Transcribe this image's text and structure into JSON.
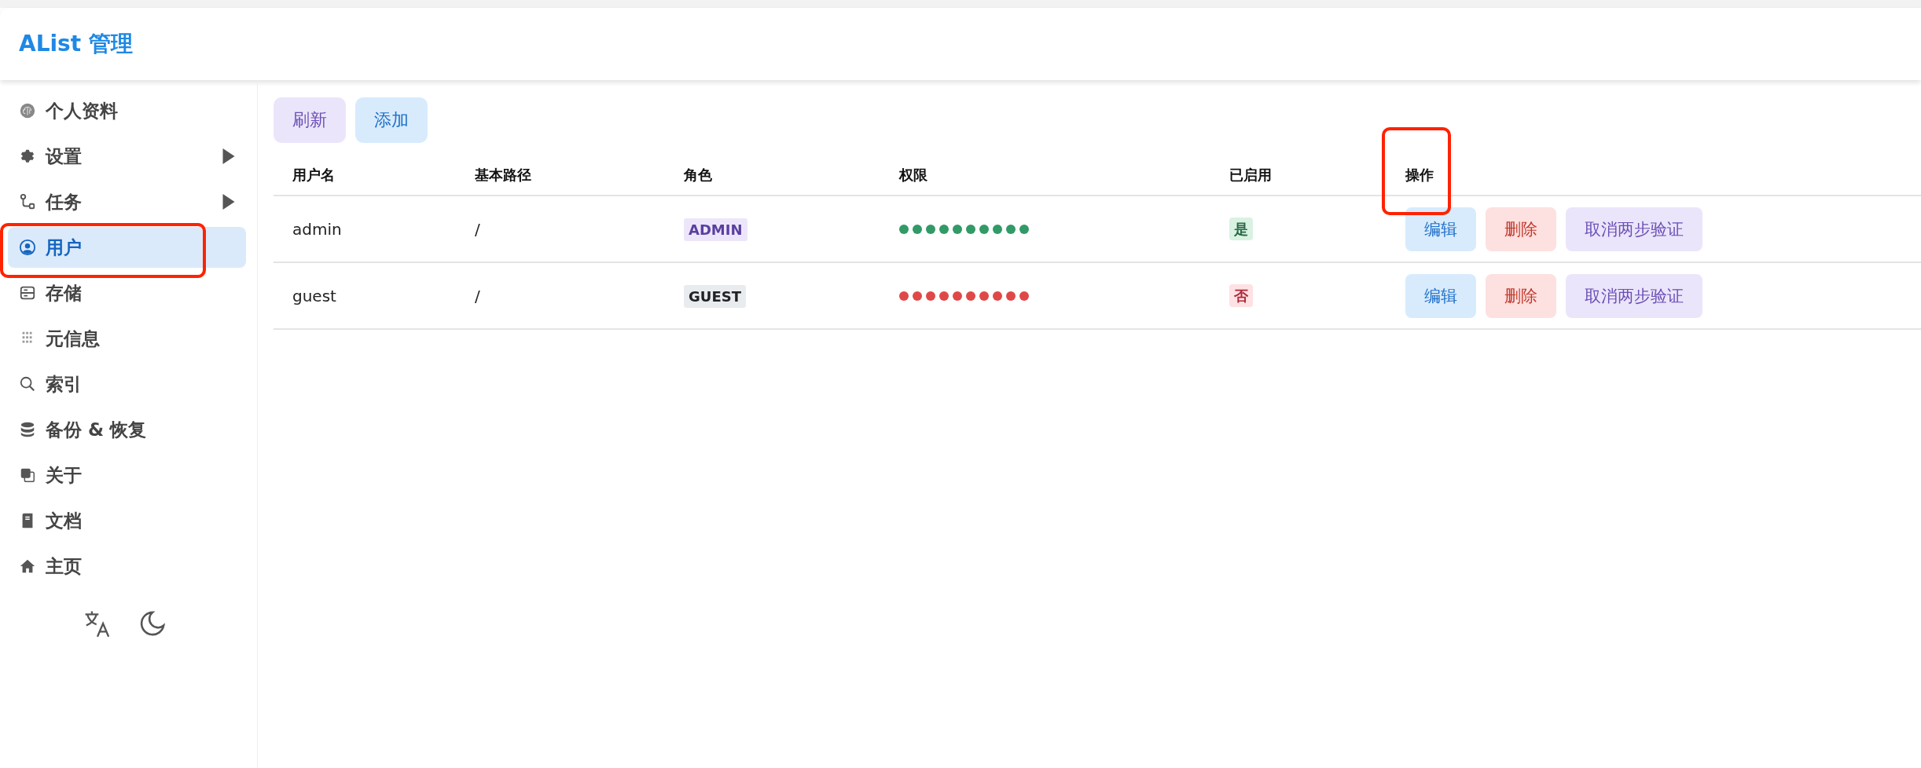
{
  "header": {
    "title": "AList 管理"
  },
  "sidebar": {
    "items": [
      {
        "label": "个人资料",
        "selected": false,
        "expandable": false,
        "annotated": false
      },
      {
        "label": "设置",
        "selected": false,
        "expandable": true,
        "annotated": false
      },
      {
        "label": "任务",
        "selected": false,
        "expandable": true,
        "annotated": false
      },
      {
        "label": "用户",
        "selected": true,
        "expandable": false,
        "annotated": true
      },
      {
        "label": "存储",
        "selected": false,
        "expandable": false,
        "annotated": false
      },
      {
        "label": "元信息",
        "selected": false,
        "expandable": false,
        "annotated": false
      },
      {
        "label": "索引",
        "selected": false,
        "expandable": false,
        "annotated": false
      },
      {
        "label": "备份 & 恢复",
        "selected": false,
        "expandable": false,
        "annotated": false
      },
      {
        "label": "关于",
        "selected": false,
        "expandable": false,
        "annotated": false
      },
      {
        "label": "文档",
        "selected": false,
        "expandable": false,
        "annotated": false
      },
      {
        "label": "主页",
        "selected": false,
        "expandable": false,
        "annotated": false
      }
    ]
  },
  "toolbar": {
    "buttons": [
      {
        "label": "刷新",
        "kind": "neutral"
      },
      {
        "label": "添加",
        "kind": "info"
      }
    ]
  },
  "table": {
    "columns": [
      "用户名",
      "基本路径",
      "角色",
      "权限",
      "已启用",
      "操作"
    ],
    "actions_annotated": true,
    "rows": [
      {
        "username": "admin",
        "base_path": "/",
        "role": {
          "label": "ADMIN",
          "kind": "admin"
        },
        "permissions": [
          true,
          true,
          true,
          true,
          true,
          true,
          true,
          true,
          true,
          true
        ],
        "enabled": {
          "label": "是",
          "on": true
        },
        "actions": [
          {
            "label": "编辑",
            "kind": "info"
          },
          {
            "label": "删除",
            "kind": "danger"
          },
          {
            "label": "取消两步验证",
            "kind": "neutral"
          }
        ]
      },
      {
        "username": "guest",
        "base_path": "/",
        "role": {
          "label": "GUEST",
          "kind": "guest"
        },
        "permissions": [
          false,
          false,
          false,
          false,
          false,
          false,
          false,
          false,
          false,
          false
        ],
        "enabled": {
          "label": "否",
          "on": false
        },
        "actions": [
          {
            "label": "编辑",
            "kind": "info"
          },
          {
            "label": "删除",
            "kind": "danger"
          },
          {
            "label": "取消两步验证",
            "kind": "neutral"
          }
        ]
      }
    ]
  }
}
